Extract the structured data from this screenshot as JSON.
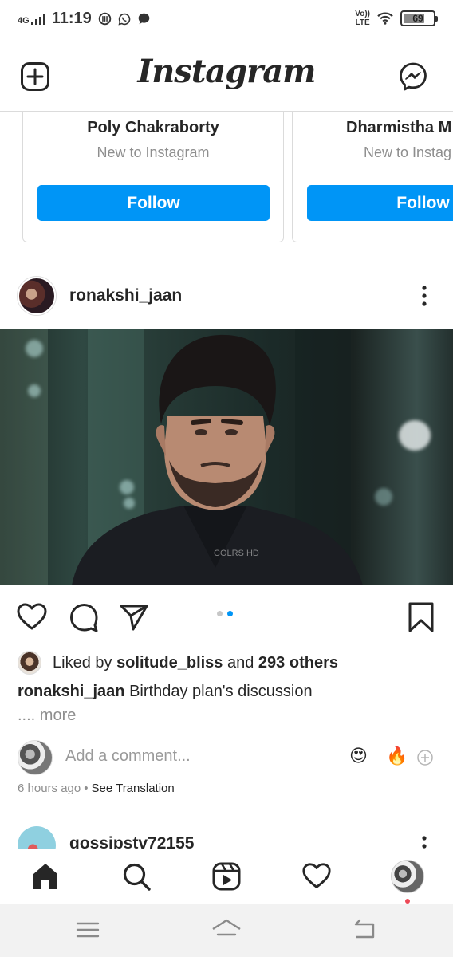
{
  "status_bar": {
    "network": "4G",
    "time": "11:19",
    "notification_icons": [
      "data-saver-icon",
      "whatsapp-icon",
      "chat-bubble-icon"
    ],
    "volte": "Vo)) LTE",
    "battery_level": "69",
    "battery_fraction": 0.69
  },
  "header": {
    "logo_text": "Instagram",
    "new_post_icon": "plus-square-icon",
    "messenger_icon": "messenger-icon"
  },
  "suggestions": [
    {
      "name": "Poly Chakraborty",
      "subtitle": "New to Instagram",
      "button_label": "Follow"
    },
    {
      "name": "Dharmistha M",
      "subtitle": "New to Instag",
      "button_label": "Follow"
    }
  ],
  "post": {
    "username": "ronakshi_jaan",
    "carousel_total": 2,
    "carousel_active": 2,
    "watermark": "COLRS HD",
    "liked_by_prefix": "Liked by ",
    "liked_by_user": "solitude_bliss",
    "liked_by_middle": " and ",
    "liked_by_others": "293 others",
    "caption_user": "ronakshi_jaan",
    "caption_text": " Birthday plan's discussion",
    "more_label": ".... more",
    "comment_placeholder": "Add a comment...",
    "quick_emojis": [
      "😍",
      "🔥"
    ],
    "time_ago": "6 hours ago",
    "separator": "•",
    "see_translation": "See Translation"
  },
  "next_post": {
    "username": "gossipstv72155"
  },
  "bottom_nav": [
    "home-icon",
    "search-icon",
    "reels-icon",
    "activity-heart-icon",
    "profile-avatar"
  ],
  "colors": {
    "accent": "#0095f6",
    "text": "#262626",
    "muted": "#8e8e8e",
    "notification": "#ed4956"
  }
}
